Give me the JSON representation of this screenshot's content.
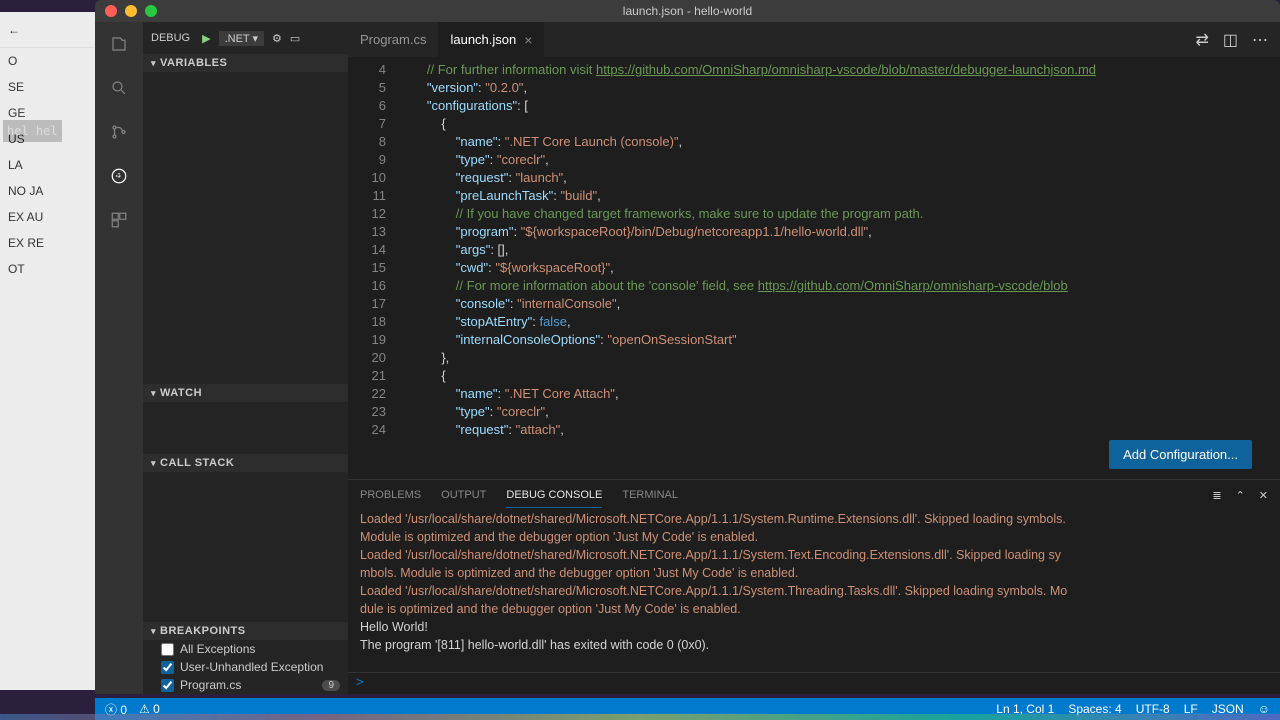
{
  "window": {
    "title": "launch.json - hello-world"
  },
  "activity": {
    "icons": [
      "files",
      "search",
      "git",
      "debug",
      "extensions"
    ]
  },
  "debug_toolbar": {
    "label": "DEBUG",
    "config": ".NET ▾"
  },
  "sidebar": {
    "sections": [
      "VARIABLES",
      "WATCH",
      "CALL STACK",
      "BREAKPOINTS"
    ],
    "breakpoints": [
      {
        "label": "All Exceptions",
        "checked": false
      },
      {
        "label": "User-Unhandled Exception",
        "checked": true
      },
      {
        "label": "Program.cs",
        "checked": true,
        "badge": "9"
      }
    ]
  },
  "tabs": [
    {
      "label": "Program.cs",
      "active": false
    },
    {
      "label": "launch.json",
      "active": true
    }
  ],
  "editor": {
    "first_line": 4,
    "lines": [
      {
        "n": 4,
        "html": "        <span class='c-com'>// For further information visit </span><span class='c-link'>https://github.com/OmniSharp/omnisharp-vscode/blob/master/debugger-launchjson.md</span>"
      },
      {
        "n": 5,
        "html": "        <span class='c-key'>\"version\"</span>: <span class='c-str'>\"0.2.0\"</span>,"
      },
      {
        "n": 6,
        "html": "        <span class='c-key'>\"configurations\"</span>: ["
      },
      {
        "n": 7,
        "html": "            {"
      },
      {
        "n": 8,
        "html": "                <span class='c-key'>\"name\"</span>: <span class='c-str'>\".NET Core Launch (console)\"</span>,"
      },
      {
        "n": 9,
        "html": "                <span class='c-key'>\"type\"</span>: <span class='c-str'>\"coreclr\"</span>,"
      },
      {
        "n": 10,
        "html": "                <span class='c-key'>\"request\"</span>: <span class='c-str'>\"launch\"</span>,"
      },
      {
        "n": 11,
        "html": "                <span class='c-key'>\"preLaunchTask\"</span>: <span class='c-str'>\"build\"</span>,"
      },
      {
        "n": 12,
        "html": "                <span class='c-com'>// If you have changed target frameworks, make sure to update the program path.</span>"
      },
      {
        "n": 13,
        "html": "                <span class='c-key'>\"program\"</span>: <span class='c-str'>\"${workspaceRoot}/bin/Debug/netcoreapp1.1/hello-world.dll\"</span>,"
      },
      {
        "n": 14,
        "html": "                <span class='c-key'>\"args\"</span>: [],"
      },
      {
        "n": 15,
        "html": "                <span class='c-key'>\"cwd\"</span>: <span class='c-str'>\"${workspaceRoot}\"</span>,"
      },
      {
        "n": 16,
        "html": "                <span class='c-com'>// For more information about the 'console' field, see </span><span class='c-link'>https://github.com/OmniSharp/omnisharp-vscode/blob</span>"
      },
      {
        "n": 17,
        "html": "                <span class='c-key'>\"console\"</span>: <span class='c-str'>\"internalConsole\"</span>,"
      },
      {
        "n": 18,
        "html": "                <span class='c-key'>\"stopAtEntry\"</span>: <span class='c-kw'>false</span>,"
      },
      {
        "n": 19,
        "html": "                <span class='c-key'>\"internalConsoleOptions\"</span>: <span class='c-str'>\"openOnSessionStart\"</span>"
      },
      {
        "n": 20,
        "html": "            },"
      },
      {
        "n": 21,
        "html": "            {"
      },
      {
        "n": 22,
        "html": "                <span class='c-key'>\"name\"</span>: <span class='c-str'>\".NET Core Attach\"</span>,"
      },
      {
        "n": 23,
        "html": "                <span class='c-key'>\"type\"</span>: <span class='c-str'>\"coreclr\"</span>,"
      },
      {
        "n": 24,
        "html": "                <span class='c-key'>\"request\"</span>: <span class='c-str'>\"attach\"</span>,"
      }
    ],
    "add_config": "Add Configuration..."
  },
  "panel": {
    "tabs": [
      "PROBLEMS",
      "OUTPUT",
      "DEBUG CONSOLE",
      "TERMINAL"
    ],
    "active": 2,
    "lines": [
      "Loaded '/usr/local/share/dotnet/shared/Microsoft.NETCore.App/1.1.1/System.Runtime.Extensions.dll'. Skipped loading symbols.",
      " Module is optimized and the debugger option 'Just My Code' is enabled.",
      "Loaded '/usr/local/share/dotnet/shared/Microsoft.NETCore.App/1.1.1/System.Text.Encoding.Extensions.dll'. Skipped loading sy",
      "mbols. Module is optimized and the debugger option 'Just My Code' is enabled.",
      "Loaded '/usr/local/share/dotnet/shared/Microsoft.NETCore.App/1.1.1/System.Threading.Tasks.dll'. Skipped loading symbols. Mo",
      "dule is optimized and the debugger option 'Just My Code' is enabled."
    ],
    "out1": "Hello World!",
    "out2": "The program '[811] hello-world.dll' has exited with code 0 (0x0).",
    "prompt": ">"
  },
  "status": {
    "errors": "0",
    "warnings": "0",
    "ln": "Ln 1, Col 1",
    "spaces": "Spaces: 4",
    "enc": "UTF-8",
    "eol": "LF",
    "lang": "JSON"
  },
  "bg": {
    "term": "hel\nhel",
    "items": [
      "O",
      "SE",
      "GE",
      "US",
      "LA",
      "NO\nJA",
      "EX\nAU",
      "EX\nRE",
      "OT"
    ]
  }
}
